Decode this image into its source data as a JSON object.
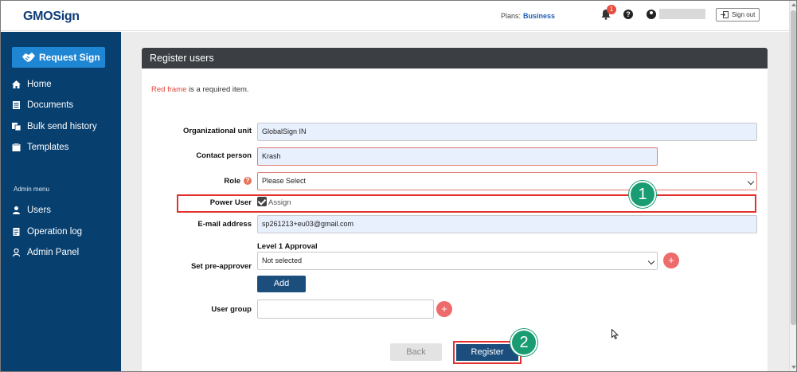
{
  "header": {
    "logo": "GMOSign",
    "plans_label": "Plans:",
    "plans_value": "Business",
    "notification_count": "1",
    "help_glyph": "?",
    "signout_label": "Sign out",
    "icons": [
      "bell-icon",
      "help-icon",
      "user-icon",
      "signout-icon"
    ]
  },
  "sidebar": {
    "request_sign_label": "Request Sign",
    "items": [
      {
        "label": "Home",
        "icon": "home-icon"
      },
      {
        "label": "Documents",
        "icon": "documents-icon"
      },
      {
        "label": "Bulk send history",
        "icon": "bulk-send-icon"
      },
      {
        "label": "Templates",
        "icon": "templates-icon"
      }
    ],
    "admin_menu_label": "Admin menu",
    "admin_items": [
      {
        "label": "Users",
        "icon": "user-icon"
      },
      {
        "label": "Operation log",
        "icon": "log-icon"
      },
      {
        "label": "Admin Panel",
        "icon": "admin-panel-icon"
      }
    ],
    "colors": {
      "background": "#073f6f",
      "button": "#1f86d4"
    }
  },
  "panel": {
    "title": "Register users",
    "required_note_red": "Red frame",
    "required_note_rest": " is a required item."
  },
  "form": {
    "org_unit_label": "Organizational unit",
    "org_unit_value": "GlobalSign IN",
    "contact_label": "Contact person",
    "contact_value": "Krash",
    "role_label": "Role",
    "role_help_glyph": "?",
    "role_value": "Please Select",
    "power_user_label": "Power User",
    "power_user_checked": true,
    "assign_label": "Assign",
    "email_label": "E-mail address",
    "email_value": "sp261213+eu03@gmail.com",
    "level_label": "Level 1 Approval",
    "preapprover_label": "Set pre-approver",
    "preapprover_value": "Not selected",
    "add_label": "Add",
    "user_group_label": "User group",
    "user_group_value": "",
    "plus_glyph": "+"
  },
  "actions": {
    "back_label": "Back",
    "register_label": "Register"
  },
  "annotations": {
    "step1": "1",
    "step2": "2",
    "highlight_color": "#e2322b",
    "step_color": "#1a9c73"
  }
}
